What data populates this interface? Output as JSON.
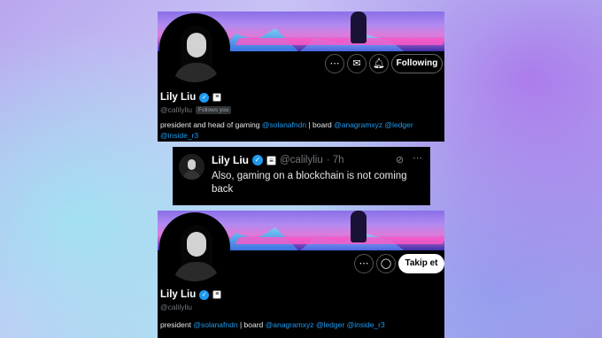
{
  "top_profile": {
    "name": "Lily Liu",
    "handle": "@calilyliu",
    "follows_you": "Follows you",
    "bio_segments": [
      {
        "text": "president and head of gaming ",
        "link": false
      },
      {
        "text": "@solanafndn",
        "link": true
      },
      {
        "text": " | board ",
        "link": false
      },
      {
        "text": "@anagramxyz",
        "link": true
      },
      {
        "text": " ",
        "link": false
      },
      {
        "text": "@ledger",
        "link": true
      },
      {
        "text": " ",
        "link": false
      },
      {
        "text": "@inside_r3",
        "link": true
      }
    ],
    "follow_button": "Following",
    "icons": {
      "more": "more-icon",
      "message": "envelope-icon",
      "subscribe": "bell-plus-icon",
      "verified": "verified-icon",
      "affiliate": "solana-badge-icon"
    }
  },
  "tweet": {
    "name": "Lily Liu",
    "handle": "@calilyliu",
    "time": "· 7h",
    "text": "Also, gaming on a blockchain is not coming back",
    "icons": {
      "grok": "grok-icon",
      "more": "more-icon",
      "verified": "verified-icon",
      "affiliate": "solana-badge-icon"
    }
  },
  "bottom_profile": {
    "name": "Lily Liu",
    "handle": "@calilyliu",
    "bio_segments": [
      {
        "text": "president ",
        "link": false
      },
      {
        "text": "@solanafndn",
        "link": true
      },
      {
        "text": " | board ",
        "link": false
      },
      {
        "text": "@anagramxyz",
        "link": true
      },
      {
        "text": " ",
        "link": false
      },
      {
        "text": "@ledger",
        "link": true
      },
      {
        "text": " ",
        "link": false
      },
      {
        "text": "@inside_r3",
        "link": true
      }
    ],
    "follow_button": "Takip et",
    "icons": {
      "more": "more-icon",
      "chat": "chat-icon",
      "verified": "verified-icon",
      "affiliate": "solana-badge-icon"
    }
  },
  "colors": {
    "link": "#1d9bf0",
    "verified": "#1d9bf0",
    "card_bg": "#000000",
    "muted_text": "#71767b"
  }
}
